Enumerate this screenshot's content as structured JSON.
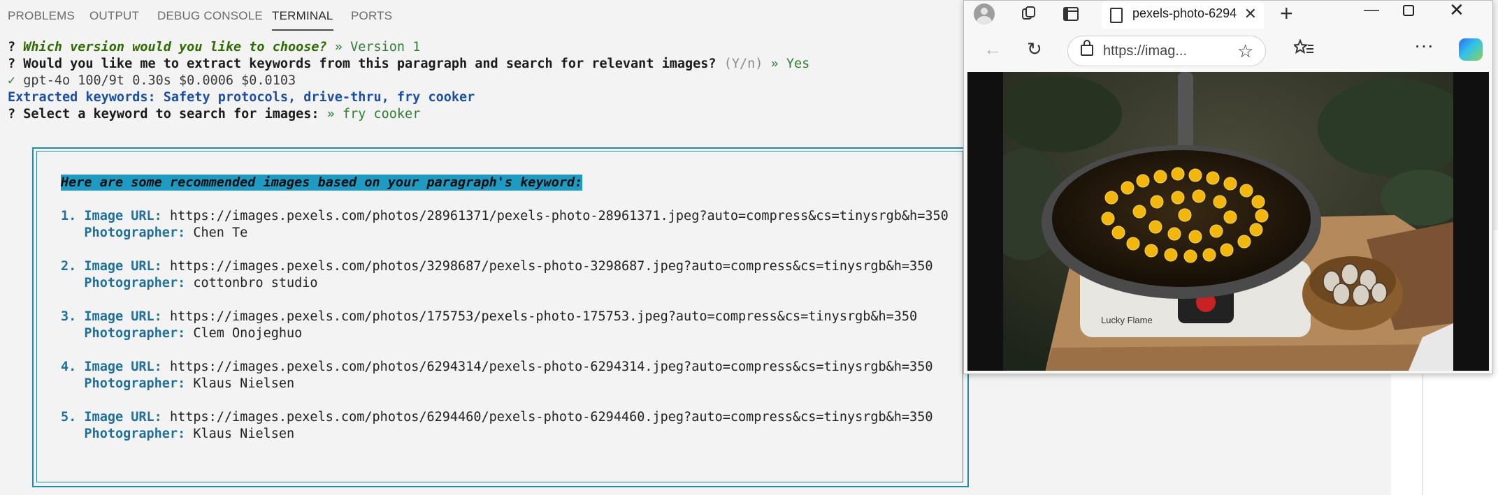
{
  "panel": {
    "tabs": [
      {
        "label": "PROBLEMS"
      },
      {
        "label": "OUTPUT"
      },
      {
        "label": "DEBUG CONSOLE"
      },
      {
        "label": "TERMINAL",
        "active": true
      },
      {
        "label": "PORTS"
      }
    ]
  },
  "terminal": {
    "line1": {
      "prefix": "? ",
      "question": "Which version would you like to choose?",
      "sep": " » ",
      "answer": "Version 1"
    },
    "line2": {
      "prefix": "? ",
      "question": "Would you like me to extract keywords from this paragraph and search for relevant images?",
      "hint": " (Y/n)",
      "sep": " » ",
      "answer": "Yes"
    },
    "line3": {
      "check": "✓",
      "text": " gpt-4o 100/9t 0.30s $0.0006 $0.0103"
    },
    "line4": {
      "label": "Extracted keywords:",
      "value": " Safety protocols, drive-thru, fry cooker"
    },
    "line5": {
      "prefix": "? ",
      "question": "Select a keyword to search for images:",
      "sep": " » ",
      "answer": "fry cooker"
    }
  },
  "results": {
    "heading": "Here are some recommended images based on your paragraph's keyword:",
    "url_label": "Image URL:",
    "photographer_label": "Photographer:",
    "items": [
      {
        "num": "1.",
        "url": "https://images.pexels.com/photos/28961371/pexels-photo-28961371.jpeg?auto=compress&cs=tinysrgb&h=350",
        "photographer": "Chen Te"
      },
      {
        "num": "2.",
        "url": "https://images.pexels.com/photos/3298687/pexels-photo-3298687.jpeg?auto=compress&cs=tinysrgb&h=350",
        "photographer": "cottonbro studio"
      },
      {
        "num": "3.",
        "url": "https://images.pexels.com/photos/175753/pexels-photo-175753.jpeg?auto=compress&cs=tinysrgb&h=350",
        "photographer": "Clem Onojeghuo"
      },
      {
        "num": "4.",
        "url": "https://images.pexels.com/photos/6294314/pexels-photo-6294314.jpeg?auto=compress&cs=tinysrgb&h=350",
        "photographer": "Klaus Nielsen"
      },
      {
        "num": "5.",
        "url": "https://images.pexels.com/photos/6294460/pexels-photo-6294460.jpeg?auto=compress&cs=tinysrgb&h=350",
        "photographer": "Klaus Nielsen"
      }
    ]
  },
  "browser": {
    "tab_title": "pexels-photo-6294",
    "url": "https://imag...",
    "icons": [
      "profile-icon",
      "collections-icon",
      "tab-actions-icon",
      "page-icon",
      "close-icon",
      "new-tab-icon",
      "minimize-icon",
      "maximize-icon",
      "window-close-icon",
      "back-icon",
      "refresh-icon",
      "lock-icon",
      "favorite-star-icon",
      "favorites-icon",
      "more-icon",
      "copilot-icon"
    ],
    "image_text": "Lucky Flame"
  },
  "colors": {
    "accent": "#1f8aa6",
    "highlight": "#1f9ac2",
    "green": "#2e7d32",
    "blue": "#1c4fa1"
  }
}
